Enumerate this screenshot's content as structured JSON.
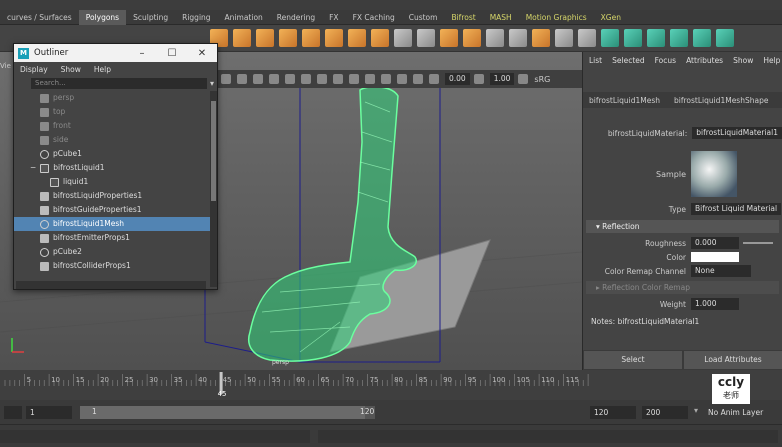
{
  "shelf": {
    "tabs": [
      "curves / Surfaces",
      "Polygons",
      "Sculpting",
      "Rigging",
      "Animation",
      "Rendering",
      "FX",
      "FX Caching",
      "Custom",
      "Bifrost",
      "MASH",
      "Motion Graphics",
      "XGen"
    ],
    "active_tab": "Polygons"
  },
  "viewport": {
    "side_label": "Vie",
    "field_a": "0.00",
    "field_b": "1.00",
    "color_space": "sRG",
    "axis_label": "persp"
  },
  "outliner": {
    "title": "Outliner",
    "menu": [
      "Display",
      "Show",
      "Help"
    ],
    "search_placeholder": "Search...",
    "items": [
      {
        "label": "persp",
        "type": "camera",
        "dim": true
      },
      {
        "label": "top",
        "type": "camera",
        "dim": true
      },
      {
        "label": "front",
        "type": "camera",
        "dim": true
      },
      {
        "label": "side",
        "type": "camera",
        "dim": true
      },
      {
        "label": "pCube1",
        "type": "mesh"
      },
      {
        "label": "bifrostLiquid1",
        "type": "liquid",
        "expand": "−"
      },
      {
        "label": "liquid1",
        "type": "liquid-child"
      },
      {
        "label": "bifrostLiquidProperties1",
        "type": "prop"
      },
      {
        "label": "bifrostGuideProperties1",
        "type": "prop"
      },
      {
        "label": "bifrostLiquid1Mesh",
        "type": "mesh",
        "selected": true
      },
      {
        "label": "bifrostEmitterProps1",
        "type": "prop"
      },
      {
        "label": "pCube2",
        "type": "mesh"
      },
      {
        "label": "bifrostColliderProps1",
        "type": "prop"
      }
    ]
  },
  "attribute_editor": {
    "menu": [
      "List",
      "Selected",
      "Focus",
      "Attributes",
      "Show",
      "Help"
    ],
    "tabs": [
      "bifrostLiquid1Mesh",
      "bifrostLiquid1MeshShape"
    ],
    "material_label": "bifrostLiquidMaterial:",
    "material_value": "bifrostLiquidMaterial1",
    "sample_label": "Sample",
    "type_label": "Type",
    "type_value": "Bifrost Liquid Material",
    "section_reflection": "Reflection",
    "roughness_label": "Roughness",
    "roughness_value": "0.000",
    "color_label": "Color",
    "color_remap_label": "Color Remap Channel",
    "color_remap_value": "None",
    "section_reflection_remap": "Reflection Color Remap",
    "weight_label": "Weight",
    "weight_value": "1.000",
    "notes": "Notes:  bifrostLiquidMaterial1",
    "select_btn": "Select",
    "load_btn": "Load Attributes"
  },
  "timeslider": {
    "ticks": [
      "5",
      "10",
      "15",
      "20",
      "25",
      "30",
      "35",
      "40",
      "45",
      "50",
      "55",
      "60",
      "65",
      "70",
      "75",
      "80",
      "85",
      "90",
      "95",
      "100",
      "105",
      "110",
      "115"
    ],
    "current": "45"
  },
  "range": {
    "start": "1",
    "inner_start": "1",
    "inner_end": "120",
    "end": "120",
    "max": "200",
    "anim_layer": "No Anim Layer"
  },
  "watermark": {
    "line1": "ccly",
    "line2": "老师"
  },
  "colors": {
    "liquid_wire": "#4dff9a",
    "selection": "#5284b3"
  }
}
